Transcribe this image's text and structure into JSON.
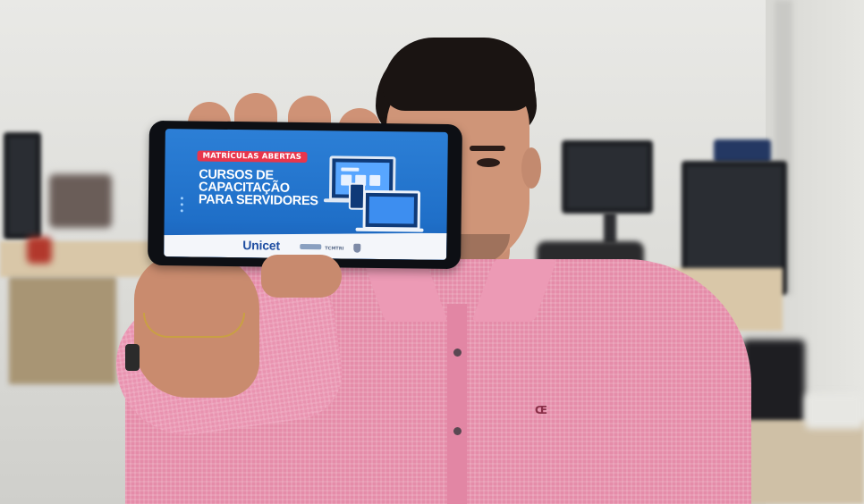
{
  "phone_ad": {
    "badge": "MATRÍCULAS ABERTAS",
    "headline_lines": [
      "CURSOS DE",
      "CAPACITAÇÃO",
      "PARA SERVIDORES"
    ],
    "brand": "Unicet",
    "partner_text": "TCMTRI",
    "colors": {
      "background": "#2c7fd6",
      "badge": "#e8364c",
      "brand": "#1f4ea1",
      "shirt": "#e58ca9"
    }
  },
  "shirt_logo": "Œ"
}
